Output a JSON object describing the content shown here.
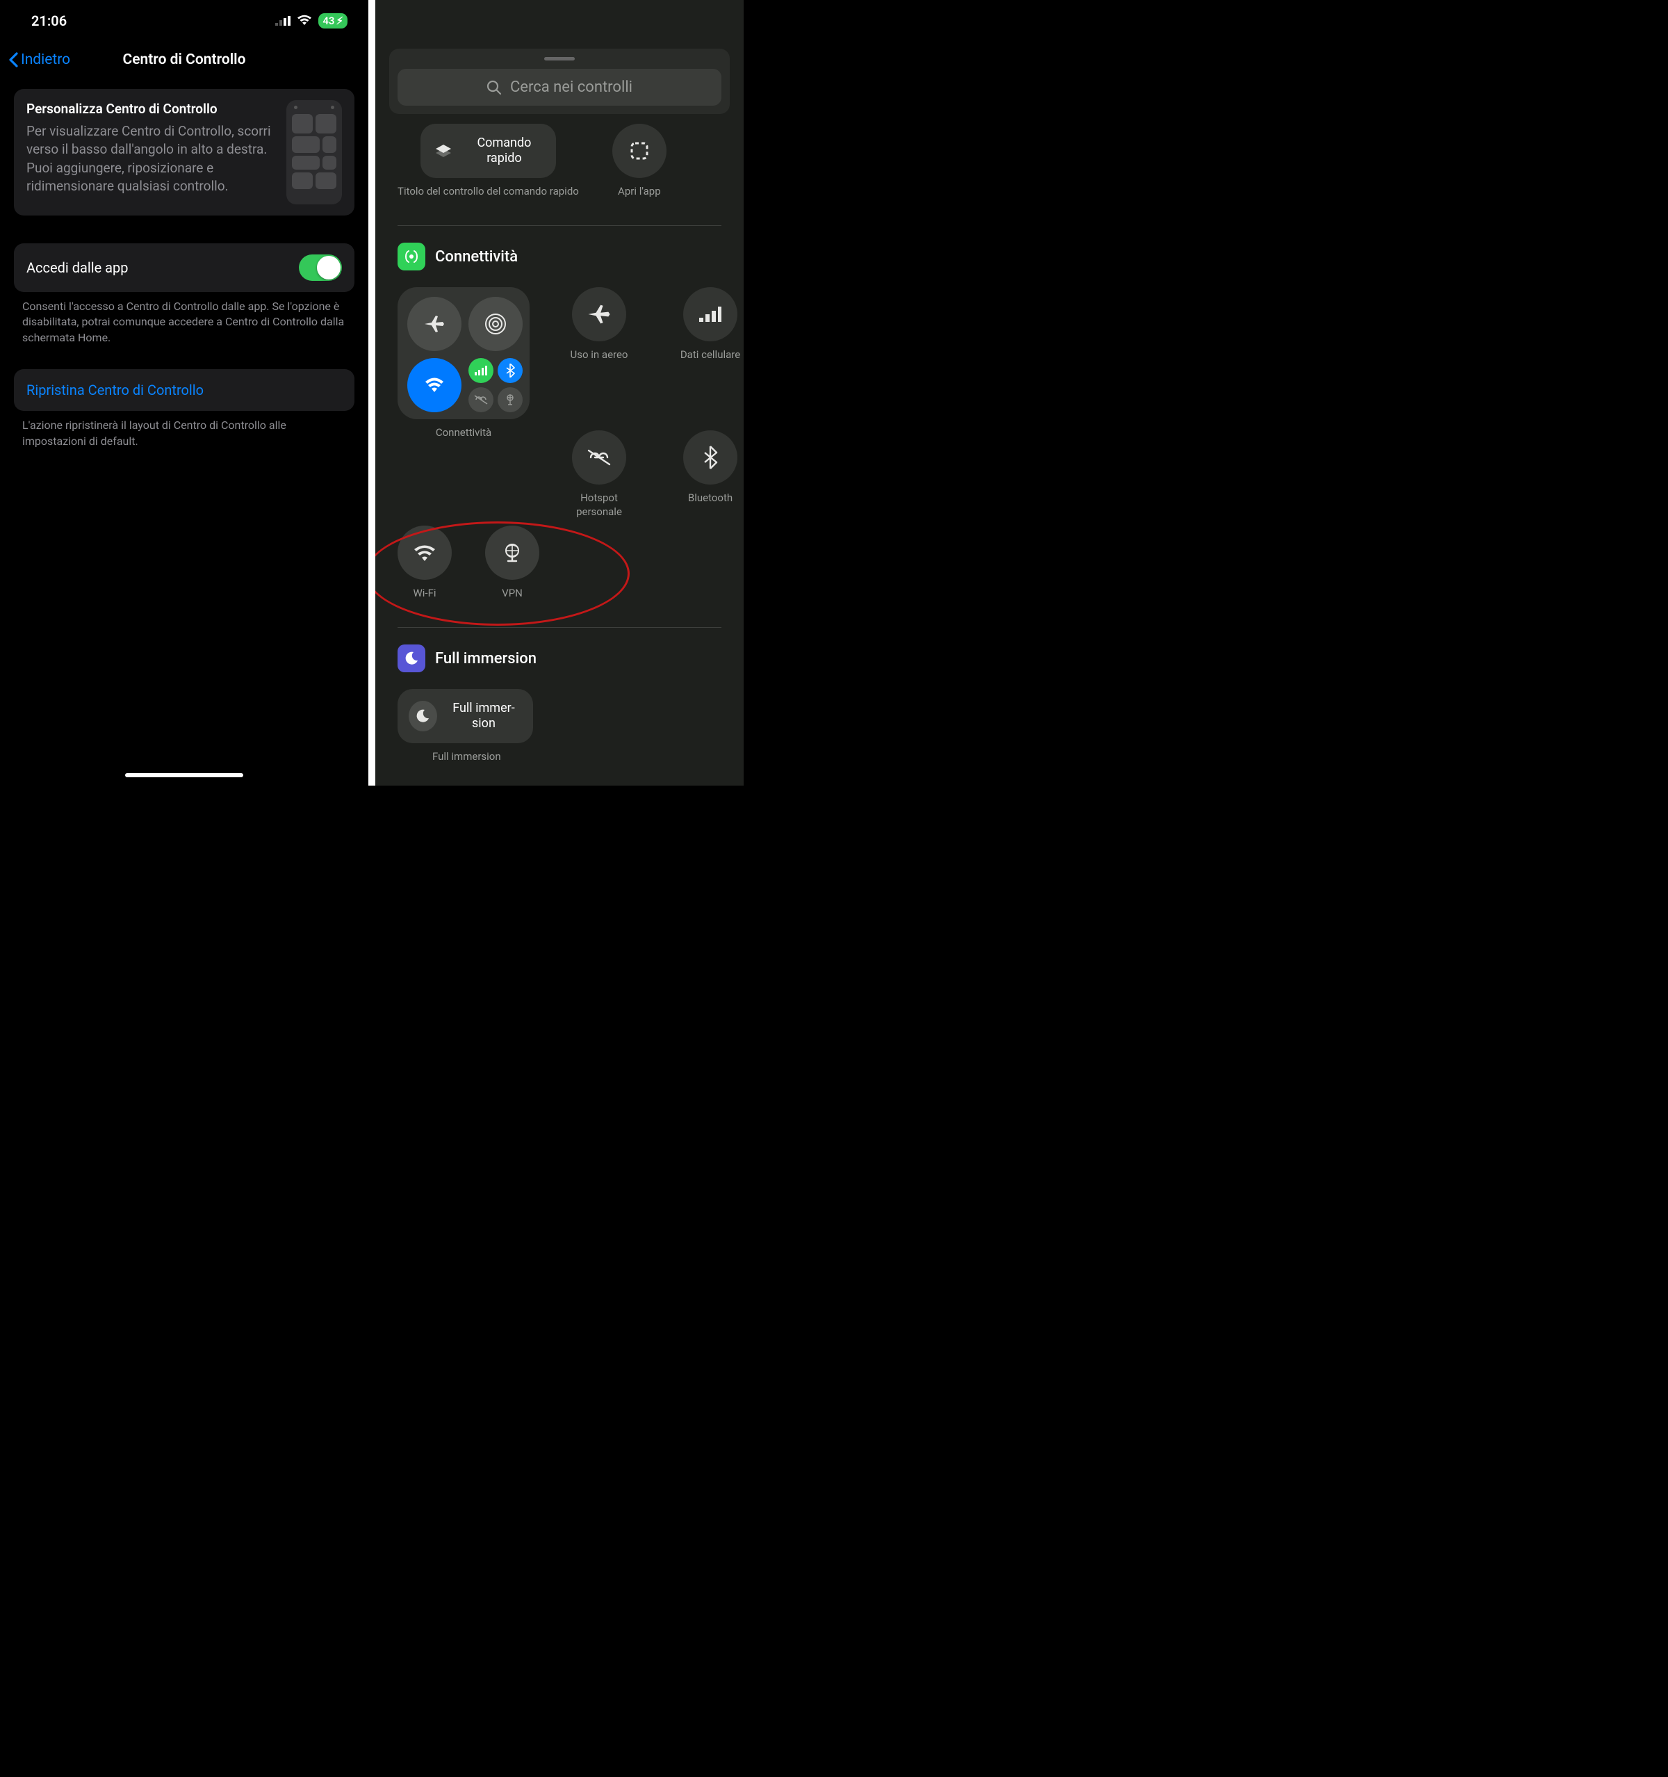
{
  "left": {
    "status": {
      "time": "21:06",
      "battery": "43"
    },
    "nav": {
      "back": "Indietro",
      "title": "Centro di Controllo"
    },
    "customize": {
      "title": "Personalizza Centro di Controllo",
      "desc": "Per visualizzare Centro di Controllo, scorri verso il basso dall'angolo in alto a destra. Puoi aggiungere, riposizionare e ridimensionare qualsiasi controllo."
    },
    "access": {
      "label": "Accedi dalle app",
      "note": "Consenti l'accesso a Centro di Controllo dalle app. Se l'opzione è disabilitata, potrai comunque accedere a Centro di Controllo dalla schermata Home."
    },
    "reset": {
      "label": "Ripristina Centro di Controllo",
      "note": "L'azione ripristinerà il layout di Centro di Controllo alle impostazioni di default."
    }
  },
  "right": {
    "search_placeholder": "Cerca nei controlli",
    "shortcut": {
      "title": "Comando rapido",
      "caption": "Titolo del controllo del comando rapido"
    },
    "open_app": {
      "caption": "Apri l'app"
    },
    "connectivity": {
      "header": "Connettività",
      "module_caption": "Connettività",
      "airplane": "Uso in aereo",
      "cellular": "Dati cellulare",
      "hotspot": "Hotspot personale",
      "bluetooth": "Bluetooth",
      "wifi": "Wi-Fi",
      "vpn": "VPN"
    },
    "focus": {
      "header": "Full immersion",
      "tile": "Full immer­sion",
      "caption": "Full immersion"
    }
  }
}
